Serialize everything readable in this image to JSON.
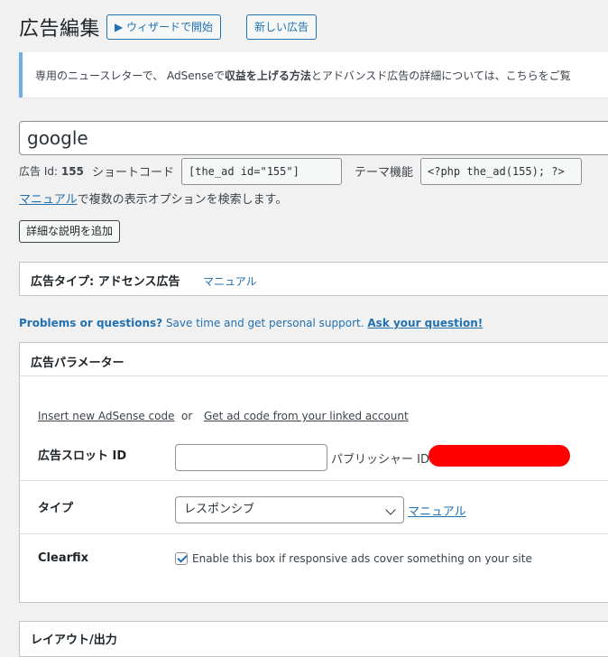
{
  "header": {
    "title": "広告編集",
    "wizard_button": "▶ ウィザードで開始",
    "new_ad_button": "新しい広告"
  },
  "notice": {
    "text_before": "専用のニュースレターで、 AdSenseで",
    "text_bold": "収益を上げる方法",
    "text_after": "とアドバンスド広告の詳細については、こちらをご覧"
  },
  "ad": {
    "title_value": "google",
    "id_label": "広告 Id:",
    "id_value": "155",
    "shortcode_label": "ショートコード",
    "shortcode_value": "[the_ad id=\"155\"]",
    "theme_label": "テーマ機能",
    "theme_value": "<?php the_ad(155); ?>",
    "manual_link": "マニュアル",
    "manual_suffix": "で複数の表示オプションを検索します。",
    "add_description_button": "詳細な説明を追加"
  },
  "ad_type_panel": {
    "title": "広告タイプ: アドセンス広告",
    "manual_link": "マニュアル"
  },
  "support": {
    "question": "Problems or questions?",
    "text": " Save time and get personal support. ",
    "link": "Ask your question!"
  },
  "params_panel": {
    "title": "広告パラメーター",
    "insert_code_link": "Insert new AdSense code",
    "or_text": "or",
    "get_code_link": "Get ad code from your linked account",
    "slot_label": "広告スロット ID",
    "slot_value": "",
    "publisher_label": "パブリッシャー ID",
    "type_label": "タイプ",
    "type_value": "レスポンシブ",
    "type_manual_link": "マニュアル",
    "clearfix_label": "Clearfix",
    "clearfix_checked": true,
    "clearfix_text": "Enable this box if responsive ads cover something on your site"
  },
  "layout_panel": {
    "title": "レイアウト/出力"
  },
  "colors": {
    "accent": "#2271b1",
    "redaction": "#ff0000",
    "notice_border": "#72aee6"
  }
}
